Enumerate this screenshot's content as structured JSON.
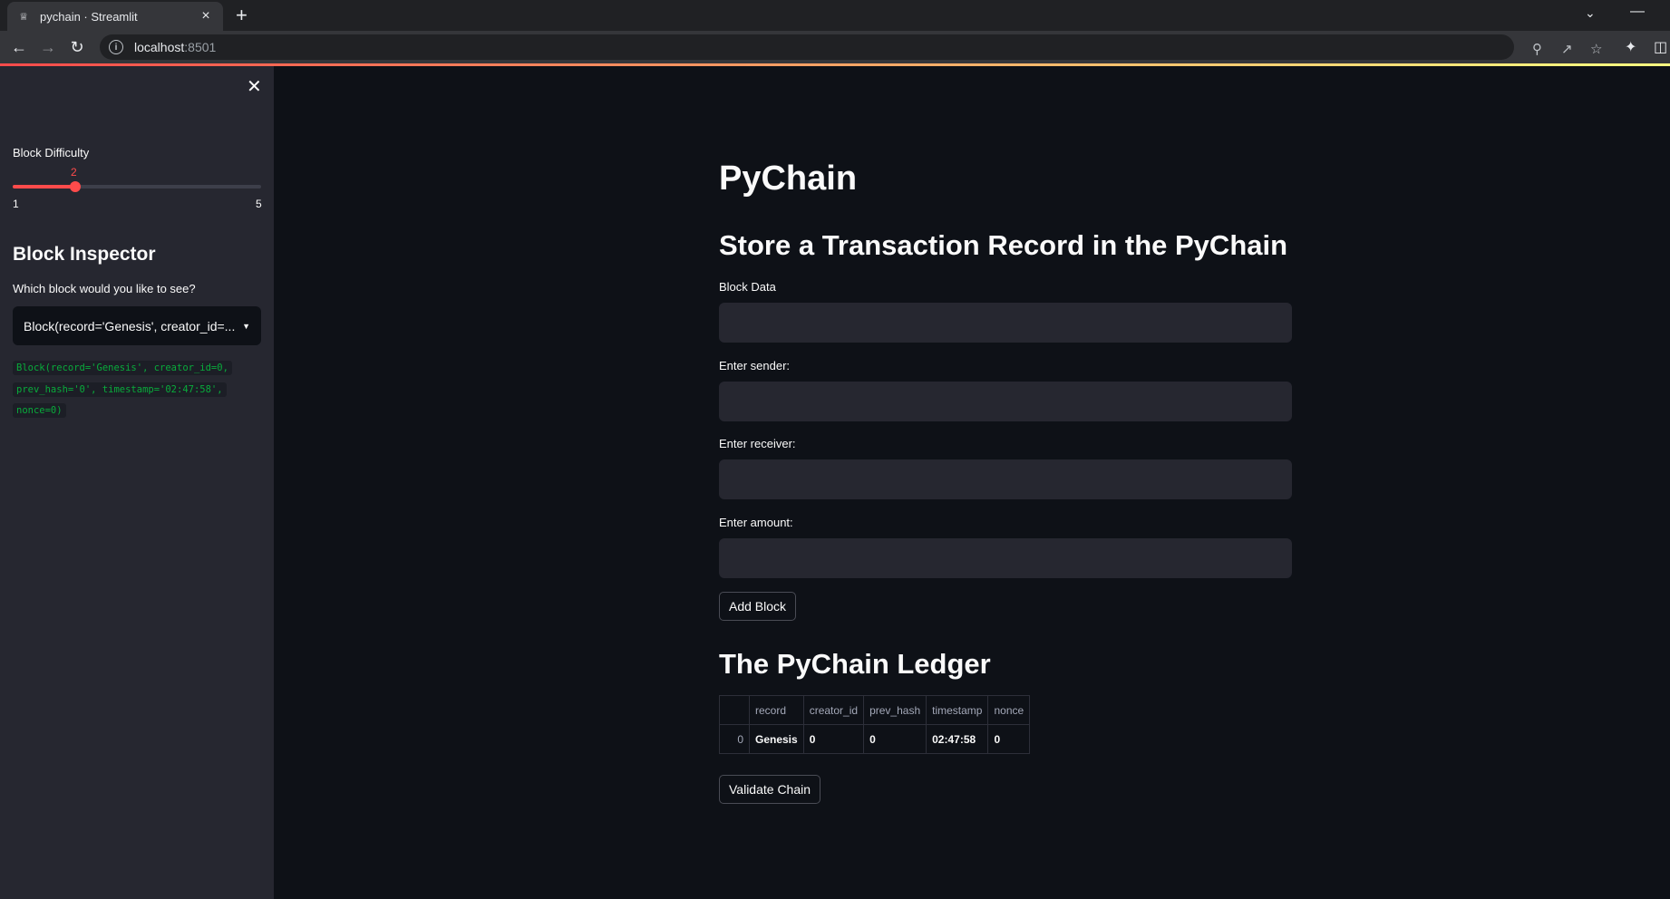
{
  "browser": {
    "tab_title": "pychain · Streamlit",
    "url_host": "localhost",
    "url_port": ":8501"
  },
  "sidebar": {
    "slider": {
      "label": "Block Difficulty",
      "value": 2,
      "value_text": "2",
      "min": 1,
      "max": 5,
      "min_text": "1",
      "max_text": "5"
    },
    "heading": "Block Inspector",
    "select": {
      "label": "Which block would you like to see?",
      "selected": "Block(record='Genesis', creator_id=..."
    },
    "code": "Block(record='Genesis', creator_id=0, prev_hash='0', timestamp='02:47:58', nonce=0)"
  },
  "main": {
    "title": "PyChain",
    "section_store": "Store a Transaction Record in the PyChain",
    "fields": {
      "block_data": "Block Data",
      "sender": "Enter sender:",
      "receiver": "Enter receiver:",
      "amount": "Enter amount:"
    },
    "add_block": "Add Block",
    "section_ledger": "The PyChain Ledger",
    "table": {
      "columns": [
        "",
        "record",
        "creator_id",
        "prev_hash",
        "timestamp",
        "nonce"
      ],
      "rows": [
        [
          "0",
          "Genesis",
          "0",
          "0",
          "02:47:58",
          "0"
        ]
      ]
    },
    "validate_chain": "Validate Chain"
  },
  "colors": {
    "primary": "#ff4b4b",
    "background": "#0e1117",
    "sidebar": "#262730",
    "code_text": "#09ab3b"
  }
}
